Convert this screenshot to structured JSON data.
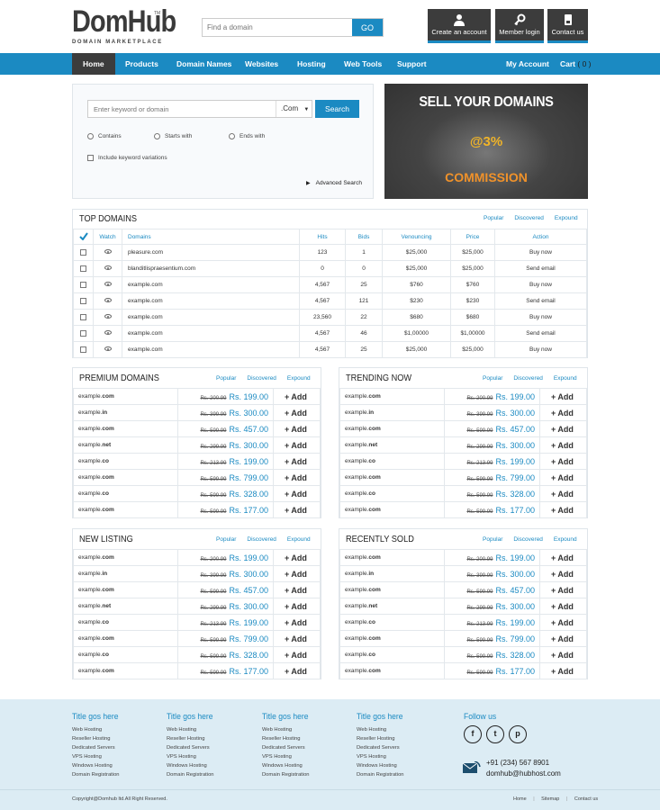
{
  "brand": {
    "name_a": "Dom",
    "name_b": "Hub",
    "tm": "TM",
    "tagline": "DOMAIN MARKETPLACE"
  },
  "top_search": {
    "placeholder": "Find a domain",
    "button": "GO"
  },
  "top_buttons": [
    {
      "label": "Create an account",
      "icon": "user-icon"
    },
    {
      "label": "Member login",
      "icon": "key-icon"
    },
    {
      "label": "Contact us",
      "icon": "phone-icon"
    }
  ],
  "nav": {
    "items": [
      "Home",
      "Products",
      "Domain Names",
      "Websites",
      "Hosting",
      "Web Tools",
      "Support"
    ],
    "my_account": "My Account",
    "cart": "Cart",
    "cart_count": "( 0 )"
  },
  "search": {
    "placeholder": "Enter keyword or domain",
    "tld": ".Com",
    "button": "Search",
    "options": [
      "Contains",
      "Starts with",
      "Ends with"
    ],
    "include": "Include keyword variations",
    "advanced": "Advanced Search"
  },
  "banner": {
    "line1": "SELL YOUR DOMAINS",
    "line2": "@3%",
    "line3": "COMMISSION"
  },
  "top_domains": {
    "title": "TOP DOMAINS",
    "links": [
      "Popular",
      "Discovered",
      "Expound"
    ],
    "headers": [
      "Watch",
      "Domains",
      "Hits",
      "Bids",
      "Venouncing",
      "Price",
      "Action"
    ],
    "rows": [
      [
        "pleasure.com",
        "123",
        "1",
        "$25,000",
        "$25,000",
        "Buy now"
      ],
      [
        "blanditlispraesentium.com",
        "0",
        "0",
        "$25,000",
        "$25,000",
        "Send email"
      ],
      [
        "example.com",
        "4,567",
        "25",
        "$760",
        "$760",
        "Buy now"
      ],
      [
        "example.com",
        "4,567",
        "121",
        "$230",
        "$230",
        "Send email"
      ],
      [
        "example.com",
        "23,560",
        "22",
        "$680",
        "$680",
        "Buy now"
      ],
      [
        "example.com",
        "4,567",
        "46",
        "$1,00000",
        "$1,00000",
        "Send email"
      ],
      [
        "example.com",
        "4,567",
        "25",
        "$25,000",
        "$25,000",
        "Buy now"
      ]
    ]
  },
  "listing_links": [
    "Popular",
    "Discovered",
    "Expound"
  ],
  "add_label": "+ Add",
  "listing_rows": [
    {
      "name": "example.",
      "ext": "com",
      "old": "Rs. 200.99",
      "new": "Rs. 199.00"
    },
    {
      "name": "example.",
      "ext": "in",
      "old": "Rs. 399.99",
      "new": "Rs. 300.00"
    },
    {
      "name": "example.",
      "ext": "com",
      "old": "Rs. 599.99",
      "new": "Rs. 457.00"
    },
    {
      "name": "example.",
      "ext": "net",
      "old": "Rs. 299.99",
      "new": "Rs. 300.00"
    },
    {
      "name": "example.",
      "ext": "co",
      "old": "Rs. 213.99",
      "new": "Rs. 199.00"
    },
    {
      "name": "example.",
      "ext": "com",
      "old": "Rs. 599.99",
      "new": "Rs. 799.00"
    },
    {
      "name": "example.",
      "ext": "co",
      "old": "Rs. 599.99",
      "new": "Rs. 328.00"
    },
    {
      "name": "example.",
      "ext": "com",
      "old": "Rs. 599.99",
      "new": "Rs. 177.00"
    }
  ],
  "panels": [
    "PREMIUM DOMAINS",
    "TRENDING NOW",
    "NEW LISTING",
    "RECENTLY SOLD"
  ],
  "footer": {
    "col_title": "Title gos here",
    "col_items": [
      "Web Hosting",
      "Reseller Hosting",
      "Dedicated Servers",
      "VPS Hosting",
      "Windows Hosting",
      "Domain Registration"
    ],
    "follow": "Follow us",
    "phone": "+91 (234) 567 8901",
    "email": "domhub@hubhost.com",
    "copyright": "Copyright@Domhub ltd.All Right Reserved.",
    "links": [
      "Home",
      "Sitemap",
      "Contact us"
    ]
  }
}
